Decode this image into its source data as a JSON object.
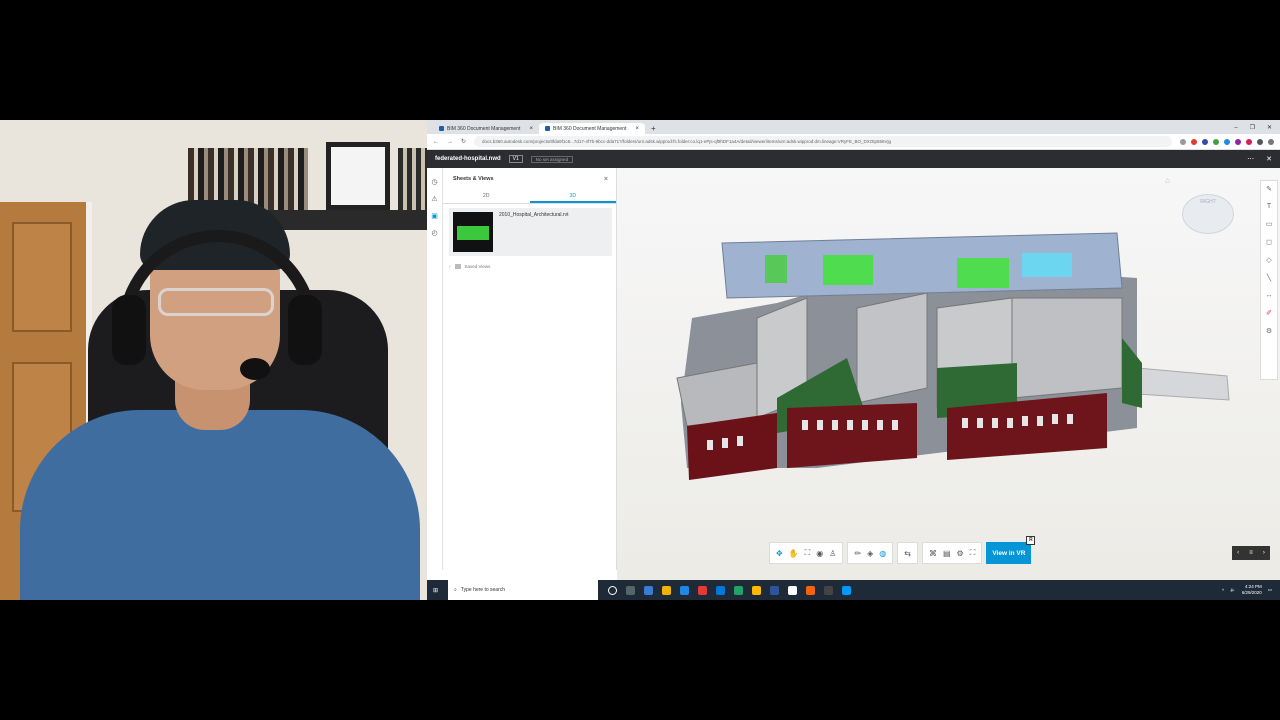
{
  "browser": {
    "tabs": [
      {
        "label": "BIM 360 Document Management"
      },
      {
        "label": "BIM 360 Document Management"
      }
    ],
    "new_tab_symbol": "+",
    "url": "docs.b360.autodesk.com/projects/8fda9f1c8...7d17-4f7b-9bcc-dda71?/folders/urn:adsk.wipprod:fs.folder:co.lq1-ePjs-qf8hDF1a4A/detail/viewer/items/urn:adsk.wipprod:dm.lineage:VRyFE_BO_DXOtp556Vjg"
  },
  "app_header": {
    "file_name": "federated-hospital.nwd",
    "version": "V1",
    "status": "No set assigned"
  },
  "panel": {
    "title": "Sheets & Views",
    "tabs": [
      "2D",
      "3D"
    ],
    "active_tab": "3D",
    "file_label": "2010_Hospital_Architectural.rvt",
    "saved_views_label": "Saved Views"
  },
  "viewer": {
    "view_cube_label": "RIGHT",
    "vr_button_label": "View in VR",
    "vr_badge": "R"
  },
  "taskbar": {
    "search_placeholder": "Type here to search",
    "time": "4:24 PM",
    "date": "6/29/2020"
  },
  "colors": {
    "accent": "#0696d7",
    "header": "#2b2d31",
    "taskbar": "#1f2a38"
  }
}
